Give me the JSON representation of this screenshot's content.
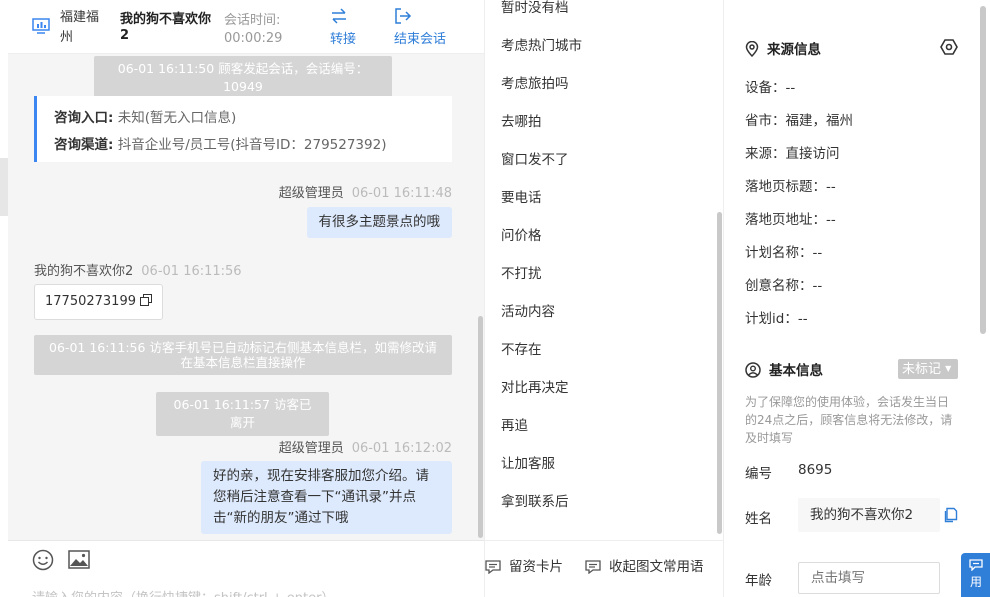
{
  "header": {
    "location": "福建福州",
    "visitor_name": "我的狗不喜欢你2",
    "session_time_label": "会话时间:",
    "session_time": "00:00:29",
    "transfer_label": "转接",
    "end_label": "结束会话"
  },
  "messages": {
    "sys_start": "06-01 16:11:50 顾客发起会话，会话编号：10949",
    "entry_label": "咨询入口:",
    "entry_value": "未知(暂无入口信息)",
    "channel_label": "咨询渠道:",
    "channel_value": "抖音企业号/员工号(抖音号ID：279527392)",
    "msg1_sender": "超级管理员",
    "msg1_time": "06-01 16:11:48",
    "msg1_text": "有很多主题景点的哦",
    "msg2_sender": "我的狗不喜欢你2",
    "msg2_time": "06-01 16:11:56",
    "msg2_text": "17750273199",
    "sys_phone": "06-01 16:11:56 访客手机号已自动标记右侧基本信息栏，如需修改请在基本信息栏直接操作",
    "sys_left": "06-01 16:11:57 访客已离开",
    "msg3_sender": "超级管理员",
    "msg3_time": "06-01 16:12:02",
    "msg3_text": "好的亲，现在安排客服加您介绍。请您稍后注意查看一下“通讯录”并点击“新的朋友”通过下哦"
  },
  "input": {
    "placeholder": "请输入您的内容（换行快捷键：shift/ctrl + enter）"
  },
  "quick_replies": {
    "items": [
      "暂时没有档",
      "考虑热门城市",
      "考虑旅拍吗",
      "去哪拍",
      "窗口发不了",
      "要电话",
      "问价格",
      "不打扰",
      "活动内容",
      "不存在",
      "对比再决定",
      "再追",
      "让加客服",
      "拿到联系后"
    ],
    "card_label": "留资卡片",
    "collapse_label": "收起图文常用语"
  },
  "source_info": {
    "title": "来源信息",
    "device": "设备：--",
    "province": "省市：福建，福州",
    "source": "来源：直接访问",
    "landing_title": "落地页标题：--",
    "landing_url": "落地页地址：--",
    "plan_name": "计划名称：--",
    "creative_name": "创意名称：--",
    "plan_id": "计划id：--"
  },
  "basic_info": {
    "title": "基本信息",
    "tag": "未标记",
    "hint": "为了保障您的使用体验，会话发生当日的24点之后，顾客信息将无法修改，请及时填写",
    "id_label": "编号",
    "id_value": "8695",
    "name_label": "姓名",
    "name_value": "我的狗不喜欢你2",
    "age_label": "年龄",
    "age_placeholder": "点击填写"
  },
  "float_button": "用",
  "colors": {
    "accent": "#2f7ed8",
    "bubble": "#dde9fc",
    "system_pill": "#d5d5d5"
  }
}
